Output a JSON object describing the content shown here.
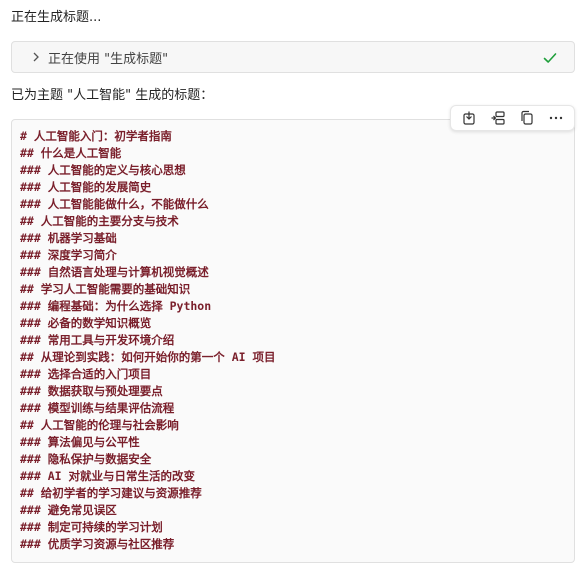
{
  "status": {
    "generating_text": "正在生成标题..."
  },
  "tool_call": {
    "label": "正在使用 \"生成标题\"",
    "chevron_icon": "chevron-right-icon",
    "status_icon": "checkmark-icon",
    "status_color": "#1f9f3b"
  },
  "intro": {
    "text": "已为主题 \"人工智能\" 生成的标题："
  },
  "toolbar": {
    "icons": [
      "insert-icon",
      "split-icon",
      "copy-icon",
      "more-icon"
    ]
  },
  "code_block": {
    "text_color": "#7a1f2b",
    "lines": [
      "# 人工智能入门：初学者指南",
      "## 什么是人工智能",
      "### 人工智能的定义与核心思想",
      "### 人工智能的发展简史",
      "### 人工智能能做什么，不能做什么",
      "## 人工智能的主要分支与技术",
      "### 机器学习基础",
      "### 深度学习简介",
      "### 自然语言处理与计算机视觉概述",
      "## 学习人工智能需要的基础知识",
      "### 编程基础：为什么选择 Python",
      "### 必备的数学知识概览",
      "### 常用工具与开发环境介绍",
      "## 从理论到实践：如何开始你的第一个 AI 项目",
      "### 选择合适的入门项目",
      "### 数据获取与预处理要点",
      "### 模型训练与结果评估流程",
      "## 人工智能的伦理与社会影响",
      "### 算法偏见与公平性",
      "### 隐私保护与数据安全",
      "### AI 对就业与日常生活的改变",
      "## 给初学者的学习建议与资源推荐",
      "### 避免常见误区",
      "### 制定可持续的学习计划",
      "### 优质学习资源与社区推荐"
    ]
  }
}
